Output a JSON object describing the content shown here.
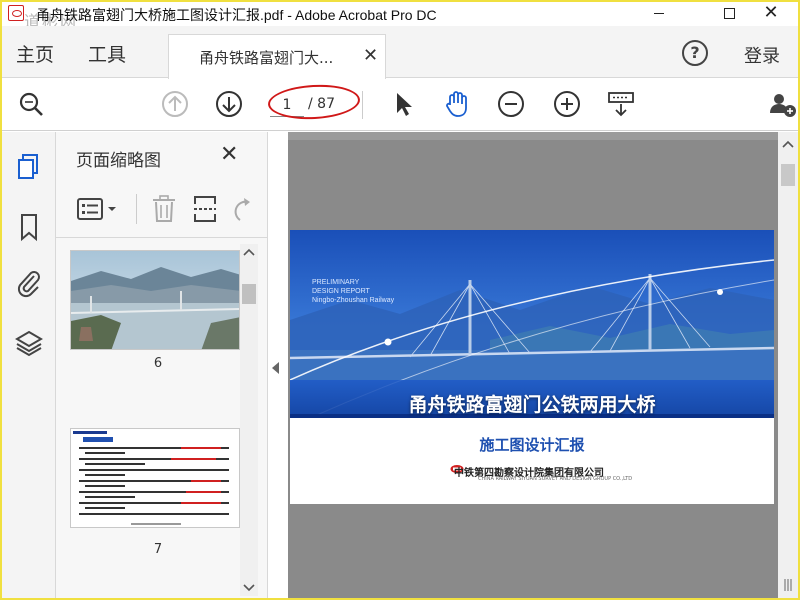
{
  "window": {
    "title": "甬舟铁路富翅门大桥施工图设计汇报.pdf - Adobe Acrobat Pro DC",
    "watermark": "道彬网"
  },
  "menu": {
    "home": "主页",
    "tools": "工具",
    "login": "登录"
  },
  "tab": {
    "label": "甬舟铁路富翅门大...",
    "close": "✕"
  },
  "toolbar": {
    "current_page": "1",
    "total_pages": "/ 87"
  },
  "thumbnail_panel": {
    "title": "页面缩略图",
    "close": "✕",
    "thumbnails": [
      {
        "label": "6"
      },
      {
        "label": "7"
      }
    ]
  },
  "document": {
    "cover_title": "甬舟铁路富翅门公铁两用大桥",
    "cover_en_1": "PRELIMINARY",
    "cover_en_2": "DESIGN REPORT",
    "cover_en_3": "Ningbo-Zhoushan Railway",
    "cover_subtitle": "施工图设计汇报",
    "org_name": "中铁第四勘察设计院集团有限公司",
    "org_name_en": "CHINA RAILWAY SIYUAN SURVEY AND DESIGN GROUP CO.,LTD"
  },
  "colors": {
    "accent": "#1a5fd0",
    "highlight_circle": "#d01818"
  }
}
